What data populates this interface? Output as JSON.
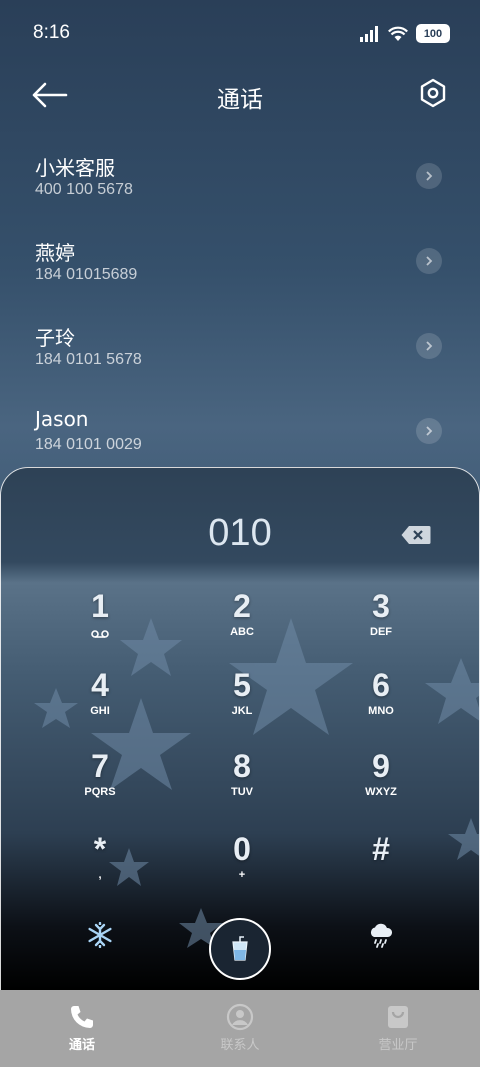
{
  "status": {
    "time": "8:16",
    "battery": "100"
  },
  "header": {
    "title": "通话"
  },
  "contacts": [
    {
      "name": "小米客服",
      "number": "400 100 5678"
    },
    {
      "name": "燕婷",
      "number": "184 01015689"
    },
    {
      "name": "子玲",
      "number": "184 0101 5678"
    },
    {
      "name": "Jason",
      "number": "184 0101 0029"
    }
  ],
  "dialer": {
    "input": "010",
    "keys": [
      {
        "digit": "1",
        "letters": ""
      },
      {
        "digit": "2",
        "letters": "ABC"
      },
      {
        "digit": "3",
        "letters": "DEF"
      },
      {
        "digit": "4",
        "letters": "GHI"
      },
      {
        "digit": "5",
        "letters": "JKL"
      },
      {
        "digit": "6",
        "letters": "MNO"
      },
      {
        "digit": "7",
        "letters": "PQRS"
      },
      {
        "digit": "8",
        "letters": "TUV"
      },
      {
        "digit": "9",
        "letters": "WXYZ"
      },
      {
        "digit": "*",
        "letters": ","
      },
      {
        "digit": "0",
        "letters": "+"
      },
      {
        "digit": "#",
        "letters": ""
      }
    ]
  },
  "tabs": [
    {
      "label": "通话",
      "active": true
    },
    {
      "label": "联系人",
      "active": false
    },
    {
      "label": "营业厅",
      "active": false
    }
  ],
  "colors": {
    "tab_inactive": "#c8c8c8",
    "tab_active": "#ffffff",
    "tabbar_bg": "#a5a5a5"
  }
}
